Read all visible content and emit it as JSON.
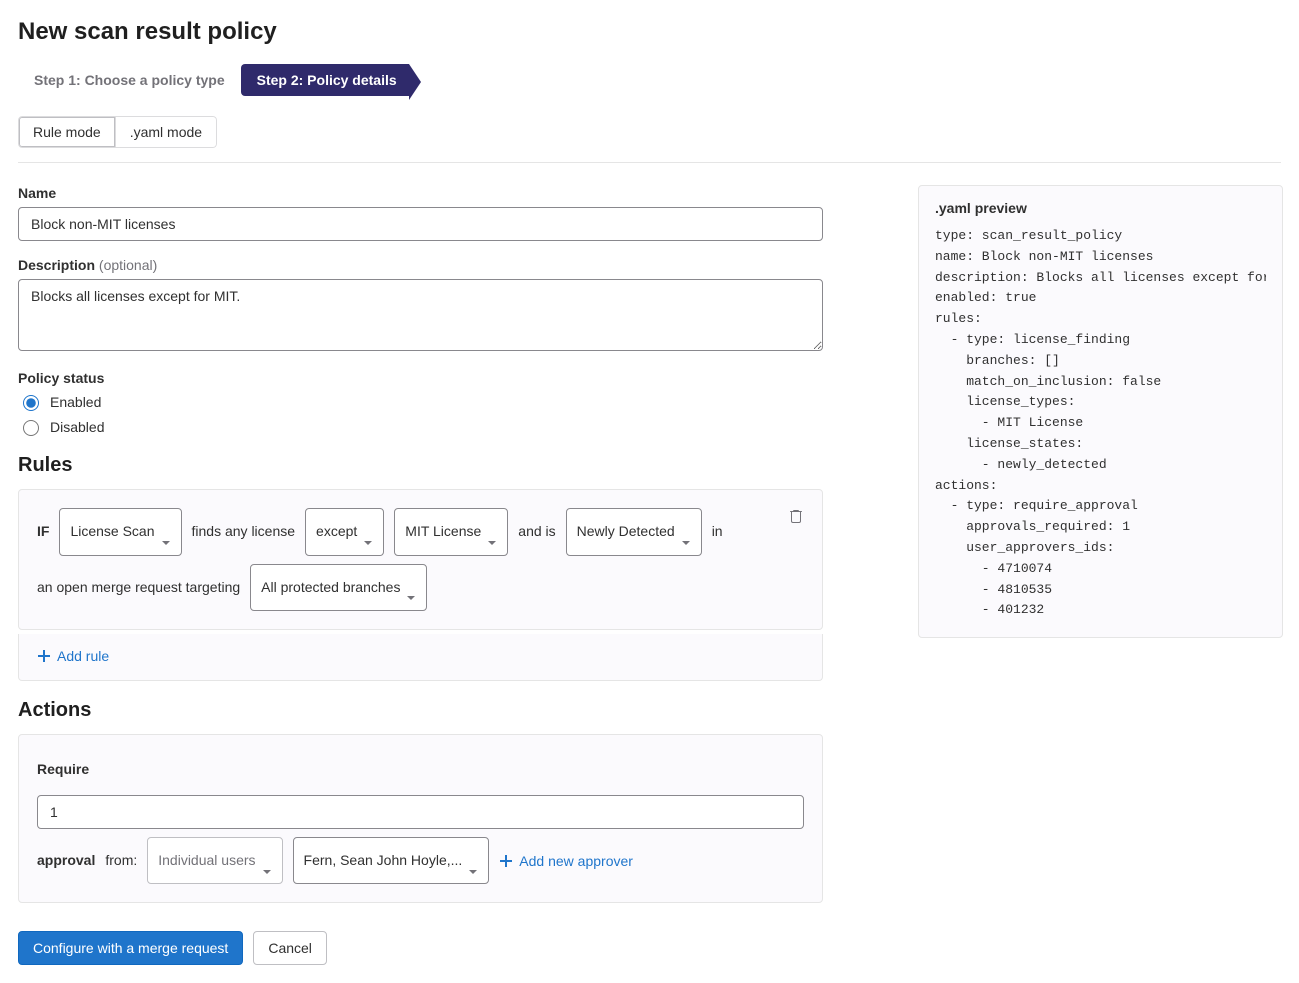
{
  "page_title": "New scan result policy",
  "steps": {
    "step1": "Step 1: Choose a policy type",
    "step2": "Step 2: Policy details"
  },
  "mode_toggle": {
    "rule": "Rule mode",
    "yaml": ".yaml mode"
  },
  "form": {
    "name_label": "Name",
    "name_value": "Block non-MIT licenses",
    "description_label": "Description",
    "description_optional": "(optional)",
    "description_value": "Blocks all licenses except for MIT.",
    "policy_status_label": "Policy status",
    "enabled_label": "Enabled",
    "disabled_label": "Disabled"
  },
  "rules": {
    "heading": "Rules",
    "if_kw": "IF",
    "scan_type": "License Scan",
    "finds_text": "finds any license",
    "match_type": "except",
    "license_type": "MIT License",
    "and_is": "and is",
    "state": "Newly Detected",
    "in_text": "in",
    "mr_text": "an open merge request targeting",
    "branches": "All protected branches",
    "add_rule": "Add rule"
  },
  "actions": {
    "heading": "Actions",
    "require_kw": "Require",
    "count": "1",
    "approval_kw": "approval",
    "from_text": "from:",
    "approver_type": "Individual users",
    "approvers": "Fern, Sean John Hoyle,...",
    "add_approver": "Add new approver"
  },
  "footer": {
    "configure": "Configure with a merge request",
    "cancel": "Cancel"
  },
  "preview": {
    "title": ".yaml preview",
    "yaml": "type: scan_result_policy\nname: Block non-MIT licenses\ndescription: Blocks all licenses except for MIT.\nenabled: true\nrules:\n  - type: license_finding\n    branches: []\n    match_on_inclusion: false\n    license_types:\n      - MIT License\n    license_states:\n      - newly_detected\nactions:\n  - type: require_approval\n    approvals_required: 1\n    user_approvers_ids:\n      - 4710074\n      - 4810535\n      - 401232"
  }
}
